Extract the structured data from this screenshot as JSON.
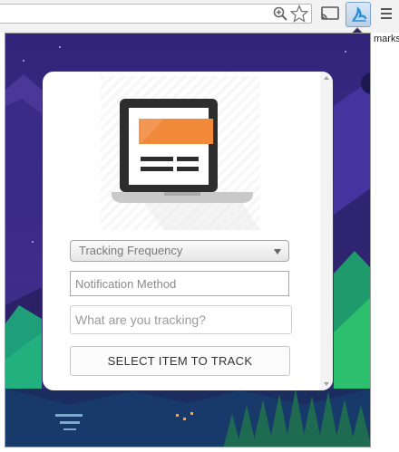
{
  "browser": {
    "bookmark_bar_text": "marks",
    "extension_icon": "tracker-extension-icon",
    "icons": [
      "zoom-icon",
      "star-icon",
      "cast-icon",
      "menu-icon"
    ]
  },
  "popup": {
    "illustration_icon": "laptop-icon",
    "frequency_select": {
      "value": "Tracking Frequency"
    },
    "notification_field": {
      "placeholder": "Notification Method",
      "value": ""
    },
    "tracking_field": {
      "placeholder": "What are you tracking?",
      "value": ""
    },
    "select_button_label": "SELECT ITEM TO TRACK"
  },
  "colors": {
    "background_sky": "#3b2a82",
    "card": "#ffffff",
    "laptop_screen_accent": "#f08a3a",
    "extension_icon": "#2a8fd4"
  }
}
